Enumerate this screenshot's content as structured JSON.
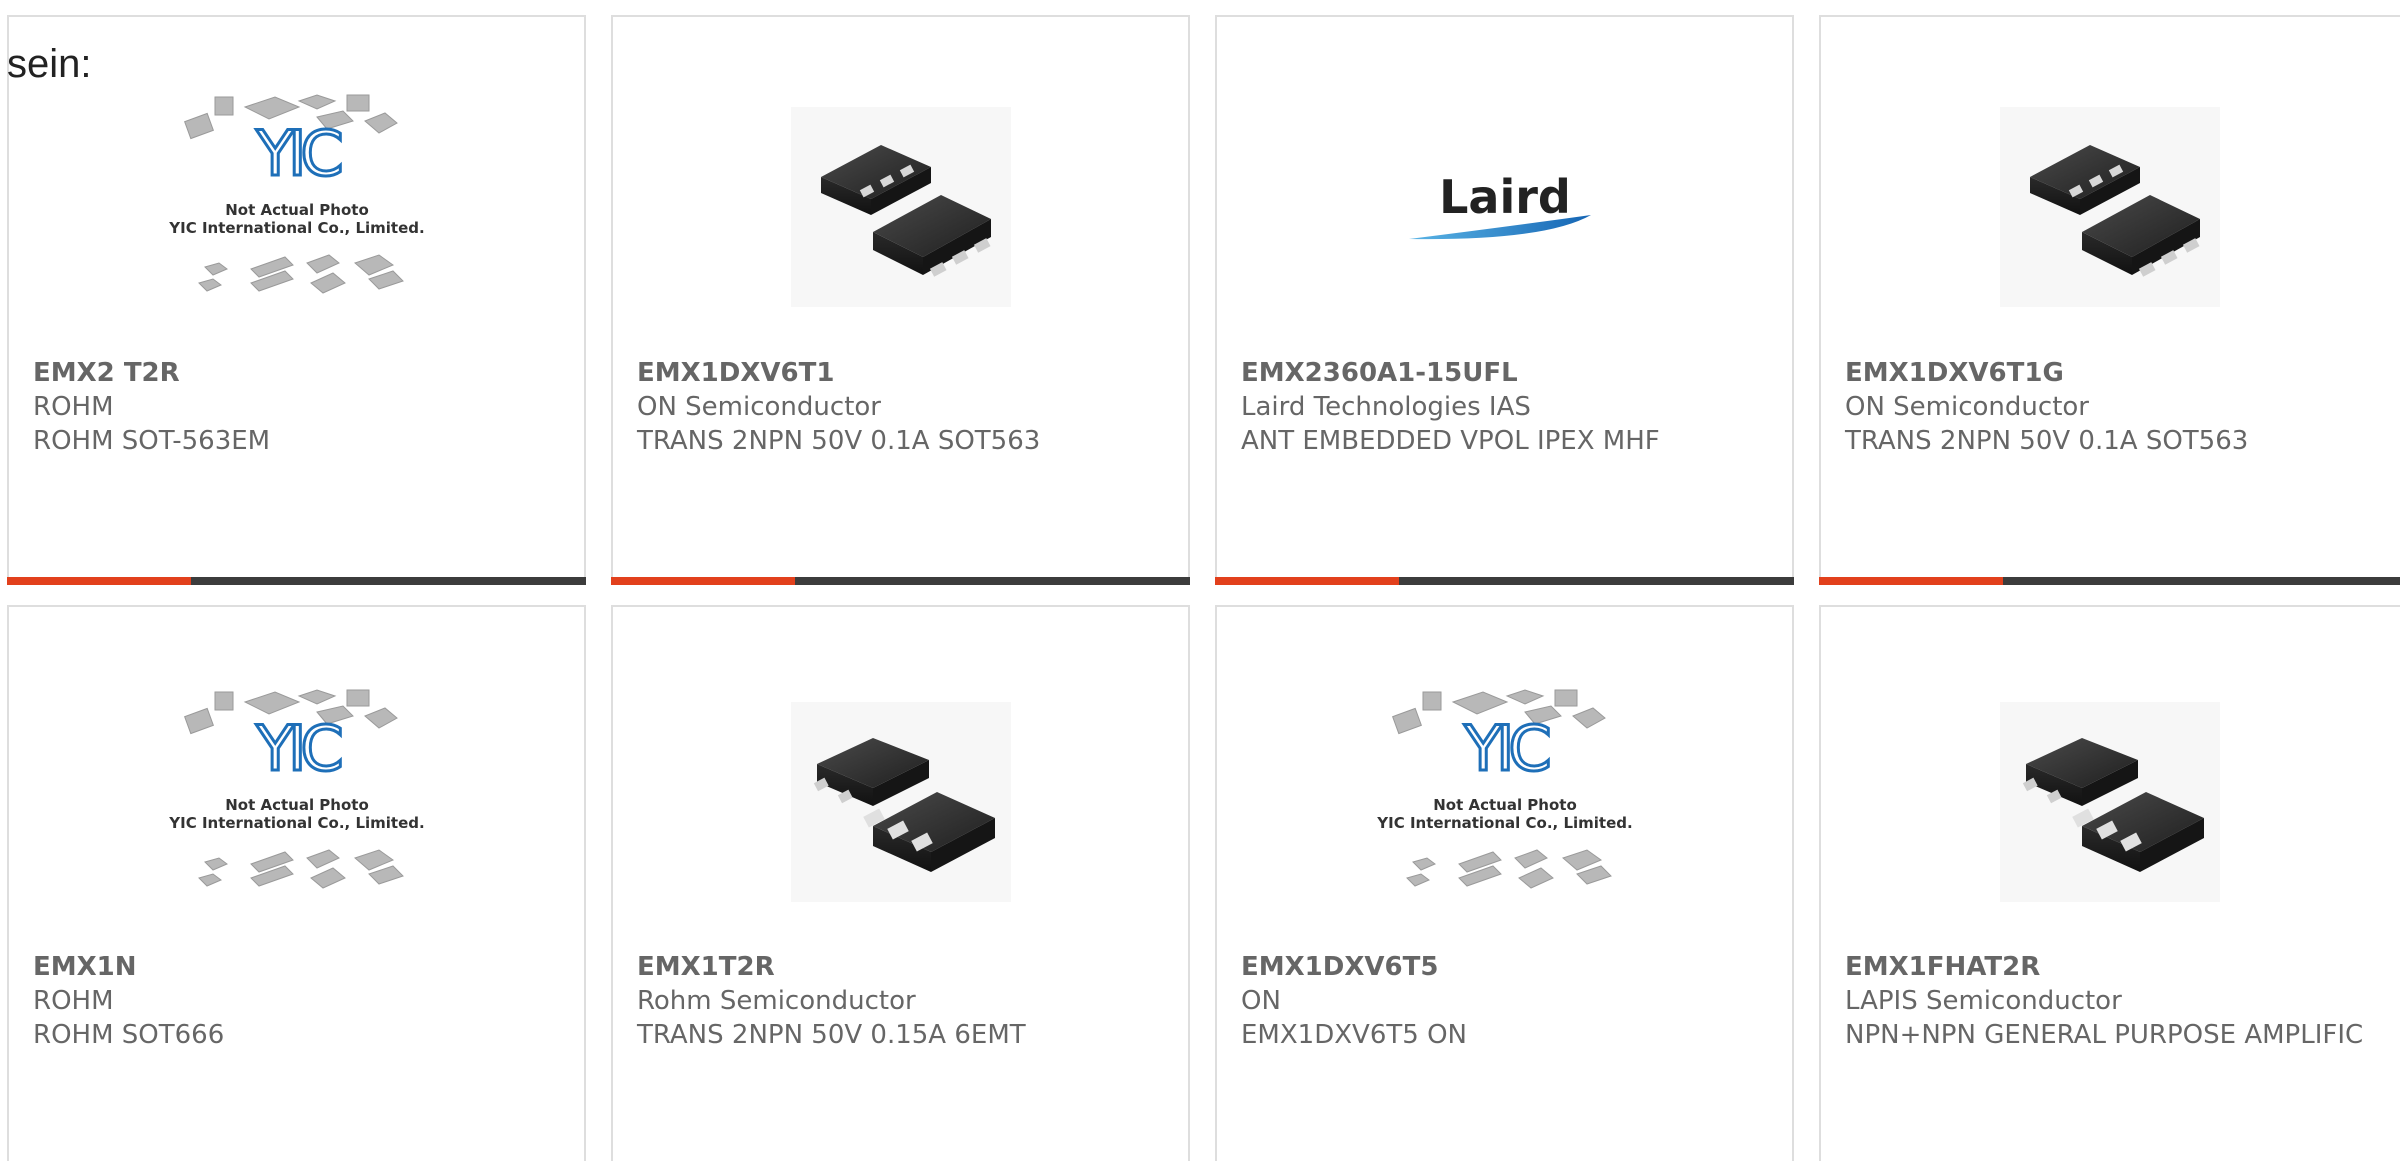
{
  "prefix_text": "sein:",
  "placeholder": {
    "caption_line1": "Not Actual Photo",
    "caption_line2": "YIC International Co., Limited.",
    "logo_text": "YIC"
  },
  "laird_logo_text": "Laird",
  "colors": {
    "accent": "#e2401c",
    "bar": "#3c3c3c",
    "text": "#666666",
    "border": "#dedede",
    "yic_blue": "#1e6fb8"
  },
  "products": [
    {
      "part": "EMX2 T2R",
      "maker": "ROHM",
      "desc": "ROHM SOT-563EM",
      "image": "yic-placeholder"
    },
    {
      "part": "EMX1DXV6T1",
      "maker": "ON Semiconductor",
      "desc": "TRANS 2NPN 50V 0.1A SOT563",
      "image": "sot563-chip"
    },
    {
      "part": "EMX2360A1-15UFL",
      "maker": "Laird Technologies IAS",
      "desc": "ANT EMBEDDED VPOL IPEX MHF",
      "image": "laird-logo"
    },
    {
      "part": "EMX1DXV6T1G",
      "maker": "ON Semiconductor",
      "desc": "TRANS 2NPN 50V 0.1A SOT563",
      "image": "sot563-chip"
    },
    {
      "part": "EMX1N",
      "maker": "ROHM",
      "desc": "ROHM SOT666",
      "image": "yic-placeholder"
    },
    {
      "part": "EMX1T2R",
      "maker": "Rohm Semiconductor",
      "desc": "TRANS 2NPN 50V 0.15A 6EMT",
      "image": "6emt-chip"
    },
    {
      "part": "EMX1DXV6T5",
      "maker": "ON",
      "desc": "EMX1DXV6T5 ON",
      "image": "yic-placeholder"
    },
    {
      "part": "EMX1FHAT2R",
      "maker": "LAPIS Semiconductor",
      "desc": "NPN+NPN GENERAL PURPOSE AMPLIFIC",
      "image": "6emt-chip"
    }
  ]
}
